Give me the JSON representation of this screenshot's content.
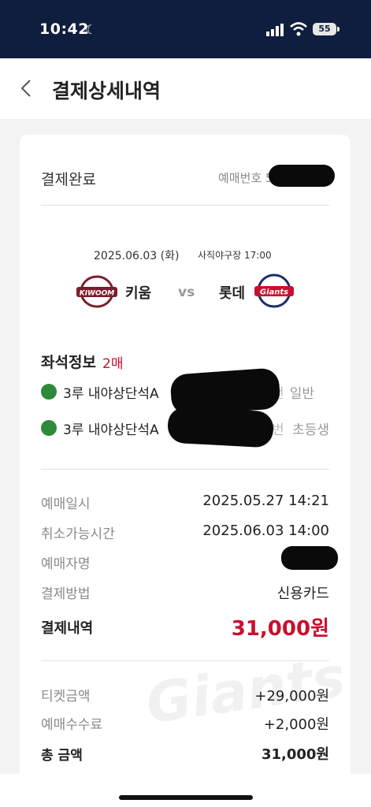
{
  "status_bar": {
    "time": "10:42",
    "battery": "55"
  },
  "header": {
    "title": "결제상세내역"
  },
  "summary": {
    "status": "결제완료",
    "booking_no_label": "예매번호 5"
  },
  "game": {
    "date": "2025.06.03 (화)",
    "venue_time": "사직야구장 17:00",
    "home_team": "키움",
    "vs": "vs",
    "away_team": "롯데",
    "home_logo_text": "KIWOOM",
    "away_logo_text": "Giants"
  },
  "seats": {
    "title": "좌석정보",
    "count": "2매",
    "items": [
      {
        "section": "3루 내야상단석A",
        "num_suffix": "번",
        "type": "일반"
      },
      {
        "section": "3루 내야상단석A",
        "num_suffix": "번",
        "type": "초등생"
      }
    ]
  },
  "details": {
    "booking_date_label": "예매일시",
    "booking_date": "2025.05.27 14:21",
    "cancel_until_label": "취소가능시간",
    "cancel_until": "2025.06.03 14:00",
    "booker_label": "예매자명",
    "payment_method_label": "결제방법",
    "payment_method": "신용카드",
    "payment_total_label": "결제내역",
    "payment_total": "31,000원"
  },
  "amounts": {
    "ticket_label": "티켓금액",
    "ticket": "+29,000원",
    "fee_label": "예매수수료",
    "fee": "+2,000원",
    "total_label": "총 금액",
    "total": "31,000원"
  },
  "watermark": "Giants",
  "colors": {
    "status_bg": "#0f1e3e",
    "accent_red": "#c8102e"
  }
}
